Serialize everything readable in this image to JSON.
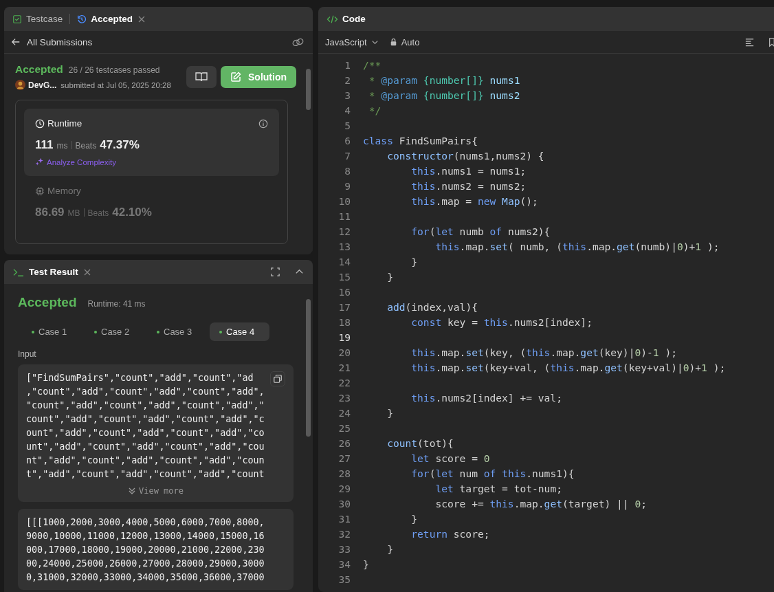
{
  "submission_panel": {
    "tabs": [
      {
        "label": "Testcase",
        "selected": false,
        "kind": "testcase"
      },
      {
        "label": "Accepted",
        "selected": true,
        "kind": "history"
      }
    ],
    "nav": {
      "back_label": "All Submissions"
    },
    "status": "Accepted",
    "passed": "26 / 26 testcases passed",
    "user": "DevG...",
    "submitted": "submitted at Jul 05, 2025 20:28",
    "solution_button": "Solution",
    "metrics": [
      {
        "kind": "runtime",
        "title": "Runtime",
        "value": "111",
        "unit": "ms",
        "beats_label": "Beats",
        "beats": "47.37%",
        "link": "Analyze Complexity",
        "selected": true
      },
      {
        "kind": "memory",
        "title": "Memory",
        "value": "86.69",
        "unit": "MB",
        "beats_label": "Beats",
        "beats": "42.10%",
        "selected": false
      }
    ]
  },
  "test_result": {
    "title": "Test Result",
    "status": "Accepted",
    "runtime": "Runtime: 41 ms",
    "cases": [
      {
        "label": "Case 1",
        "selected": false
      },
      {
        "label": "Case 2",
        "selected": false
      },
      {
        "label": "Case 3",
        "selected": false
      },
      {
        "label": "Case 4",
        "selected": true
      }
    ],
    "input_label": "Input",
    "blocks": [
      {
        "lines": [
          "[\"FindSumPairs\",\"count\",\"add\",\"count\",\"ad",
          ",\"count\",\"add\",\"count\",\"add\",\"count\",\"add\",",
          "\"count\",\"add\",\"count\",\"add\",\"count\",\"add\",\"",
          "count\",\"add\",\"count\",\"add\",\"count\",\"add\",\"c",
          "ount\",\"add\",\"count\",\"add\",\"count\",\"add\",\"co",
          "unt\",\"add\",\"count\",\"add\",\"count\",\"add\",\"cou",
          "nt\",\"add\",\"count\",\"add\",\"count\",\"add\",\"coun",
          "t\",\"add\",\"count\",\"add\",\"count\",\"add\",\"count"
        ],
        "copy": true,
        "view_more": "View more"
      },
      {
        "lines": [
          "[[[1000,2000,3000,4000,5000,6000,7000,8000,",
          "9000,10000,11000,12000,13000,14000,15000,16",
          "000,17000,18000,19000,20000,21000,22000,230",
          "00,24000,25000,26000,27000,28000,29000,3000",
          "0,31000,32000,33000,34000,35000,36000,37000"
        ],
        "copy": false
      }
    ]
  },
  "code_panel": {
    "title": "Code",
    "language": "JavaScript",
    "mode": "Auto",
    "lines": [
      {
        "number": "1",
        "tokens": [
          {
            "kind": "c",
            "text": "/**"
          }
        ]
      },
      {
        "number": "2",
        "tokens": [
          {
            "kind": "c",
            "text": " * "
          },
          {
            "kind": "t",
            "text": "@param"
          },
          {
            "kind": "ty",
            "text": " {number[]}"
          },
          {
            "kind": "v",
            "text": " nums1"
          }
        ]
      },
      {
        "number": "3",
        "tokens": [
          {
            "kind": "c",
            "text": " * "
          },
          {
            "kind": "t",
            "text": "@param"
          },
          {
            "kind": "ty",
            "text": " {number[]}"
          },
          {
            "kind": "v",
            "text": " nums2"
          }
        ]
      },
      {
        "number": "4",
        "tokens": [
          {
            "kind": "c",
            "text": " */"
          }
        ]
      },
      {
        "number": "5"
      },
      {
        "number": "6",
        "tokens": [
          {
            "kind": "k",
            "text": "class"
          },
          {
            "kind": "p",
            "text": " FindSumPairs{"
          }
        ]
      },
      {
        "number": "7",
        "tokens": [
          {
            "kind": "f",
            "text": "    constructor"
          },
          {
            "kind": "p",
            "text": "(nums1,nums2) {"
          }
        ]
      },
      {
        "number": "8",
        "tokens": [
          {
            "kind": "k",
            "text": "        this"
          },
          {
            "kind": "p",
            "text": ".nums1 = nums1;"
          }
        ]
      },
      {
        "number": "9",
        "tokens": [
          {
            "kind": "k",
            "text": "        this"
          },
          {
            "kind": "p",
            "text": ".nums2 = nums2;"
          }
        ]
      },
      {
        "number": "10",
        "tokens": [
          {
            "kind": "k",
            "text": "        this"
          },
          {
            "kind": "p",
            "text": ".map = "
          },
          {
            "kind": "k",
            "text": "new"
          },
          {
            "kind": "f",
            "text": " Map"
          },
          {
            "kind": "p",
            "text": "();"
          }
        ]
      },
      {
        "number": "11"
      },
      {
        "number": "12",
        "tokens": [
          {
            "kind": "k",
            "text": "        for"
          },
          {
            "kind": "p",
            "text": "("
          },
          {
            "kind": "k",
            "text": "let"
          },
          {
            "kind": "p",
            "text": " numb "
          },
          {
            "kind": "k",
            "text": "of"
          },
          {
            "kind": "p",
            "text": " nums2){"
          }
        ]
      },
      {
        "number": "13",
        "tokens": [
          {
            "kind": "k",
            "text": "            this"
          },
          {
            "kind": "p",
            "text": ".map."
          },
          {
            "kind": "f",
            "text": "set"
          },
          {
            "kind": "p",
            "text": "( numb, ("
          },
          {
            "kind": "k",
            "text": "this"
          },
          {
            "kind": "p",
            "text": ".map."
          },
          {
            "kind": "f",
            "text": "get"
          },
          {
            "kind": "p",
            "text": "(numb)|"
          },
          {
            "kind": "n",
            "text": "0"
          },
          {
            "kind": "p",
            "text": ")+"
          },
          {
            "kind": "n",
            "text": "1"
          },
          {
            "kind": "p",
            "text": " );"
          }
        ]
      },
      {
        "number": "14",
        "tokens": [
          {
            "kind": "p",
            "text": "        }"
          }
        ]
      },
      {
        "number": "15",
        "tokens": [
          {
            "kind": "p",
            "text": "    }"
          }
        ]
      },
      {
        "number": "16"
      },
      {
        "number": "17",
        "tokens": [
          {
            "kind": "f",
            "text": "    add"
          },
          {
            "kind": "p",
            "text": "(index,val){"
          }
        ]
      },
      {
        "number": "18",
        "tokens": [
          {
            "kind": "k",
            "text": "        const"
          },
          {
            "kind": "p",
            "text": " key = "
          },
          {
            "kind": "k",
            "text": "this"
          },
          {
            "kind": "p",
            "text": ".nums2[index];"
          }
        ]
      },
      {
        "number": "19",
        "current": true
      },
      {
        "number": "20",
        "tokens": [
          {
            "kind": "k",
            "text": "        this"
          },
          {
            "kind": "p",
            "text": ".map."
          },
          {
            "kind": "f",
            "text": "set"
          },
          {
            "kind": "p",
            "text": "(key, ("
          },
          {
            "kind": "k",
            "text": "this"
          },
          {
            "kind": "p",
            "text": ".map."
          },
          {
            "kind": "f",
            "text": "get"
          },
          {
            "kind": "p",
            "text": "(key)|"
          },
          {
            "kind": "n",
            "text": "0"
          },
          {
            "kind": "p",
            "text": ")-"
          },
          {
            "kind": "n",
            "text": "1"
          },
          {
            "kind": "p",
            "text": " );"
          }
        ]
      },
      {
        "number": "21",
        "tokens": [
          {
            "kind": "k",
            "text": "        this"
          },
          {
            "kind": "p",
            "text": ".map."
          },
          {
            "kind": "f",
            "text": "set"
          },
          {
            "kind": "p",
            "text": "(key+val, ("
          },
          {
            "kind": "k",
            "text": "this"
          },
          {
            "kind": "p",
            "text": ".map."
          },
          {
            "kind": "f",
            "text": "get"
          },
          {
            "kind": "p",
            "text": "(key+val)|"
          },
          {
            "kind": "n",
            "text": "0"
          },
          {
            "kind": "p",
            "text": ")+"
          },
          {
            "kind": "n",
            "text": "1"
          },
          {
            "kind": "p",
            "text": " );"
          }
        ]
      },
      {
        "number": "22"
      },
      {
        "number": "23",
        "tokens": [
          {
            "kind": "k",
            "text": "        this"
          },
          {
            "kind": "p",
            "text": ".nums2[index] += val;"
          }
        ]
      },
      {
        "number": "24",
        "tokens": [
          {
            "kind": "p",
            "text": "    }"
          }
        ]
      },
      {
        "number": "25"
      },
      {
        "number": "26",
        "tokens": [
          {
            "kind": "f",
            "text": "    count"
          },
          {
            "kind": "p",
            "text": "(tot){"
          }
        ]
      },
      {
        "number": "27",
        "tokens": [
          {
            "kind": "k",
            "text": "        let"
          },
          {
            "kind": "p",
            "text": " score = "
          },
          {
            "kind": "n",
            "text": "0"
          }
        ]
      },
      {
        "number": "28",
        "tokens": [
          {
            "kind": "k",
            "text": "        for"
          },
          {
            "kind": "p",
            "text": "("
          },
          {
            "kind": "k",
            "text": "let"
          },
          {
            "kind": "p",
            "text": " num "
          },
          {
            "kind": "k",
            "text": "of"
          },
          {
            "kind": "k",
            "text": " this"
          },
          {
            "kind": "p",
            "text": ".nums1){"
          }
        ]
      },
      {
        "number": "29",
        "tokens": [
          {
            "kind": "k",
            "text": "            let"
          },
          {
            "kind": "p",
            "text": " target = tot-num;"
          }
        ]
      },
      {
        "number": "30",
        "tokens": [
          {
            "kind": "p",
            "text": "            score += "
          },
          {
            "kind": "k",
            "text": "this"
          },
          {
            "kind": "p",
            "text": ".map."
          },
          {
            "kind": "f",
            "text": "get"
          },
          {
            "kind": "p",
            "text": "(target) || "
          },
          {
            "kind": "n",
            "text": "0"
          },
          {
            "kind": "p",
            "text": ";"
          }
        ]
      },
      {
        "number": "31",
        "tokens": [
          {
            "kind": "p",
            "text": "        }"
          }
        ]
      },
      {
        "number": "32",
        "tokens": [
          {
            "kind": "k",
            "text": "        return"
          },
          {
            "kind": "p",
            "text": " score;"
          }
        ]
      },
      {
        "number": "33",
        "tokens": [
          {
            "kind": "p",
            "text": "    }"
          }
        ]
      },
      {
        "number": "34",
        "tokens": [
          {
            "kind": "p",
            "text": "}"
          }
        ]
      },
      {
        "number": "35"
      }
    ]
  }
}
